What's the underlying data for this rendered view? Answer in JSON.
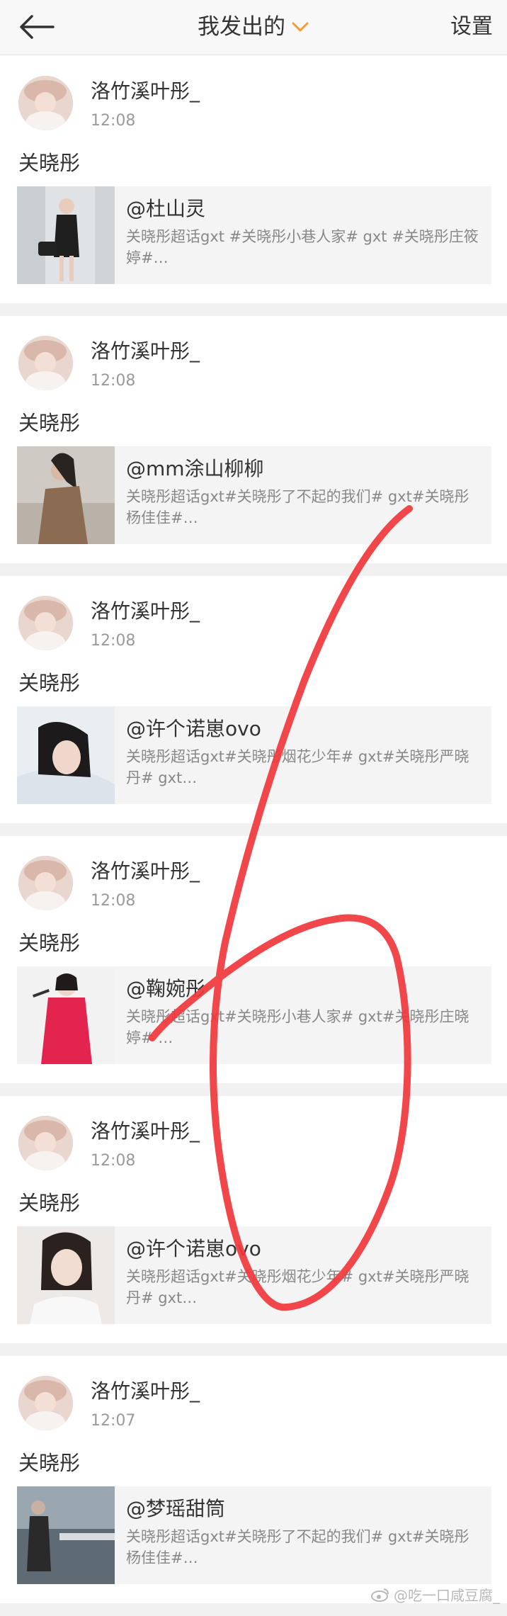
{
  "header": {
    "title": "我发出的",
    "settings_label": "设置"
  },
  "colors": {
    "accent_orange": "#f29b38",
    "annotation_red": "#f0363b"
  },
  "posts": [
    {
      "username": "洛竹溪叶彤_",
      "time": "12:08",
      "text": "关晓彤",
      "card_title": "@杜山灵",
      "card_desc": "关晓彤超话gxt #关晓彤小巷人家# gxt #关晓彤庄筱婷#…"
    },
    {
      "username": "洛竹溪叶彤_",
      "time": "12:08",
      "text": "关晓彤",
      "card_title": "@mm涂山柳柳",
      "card_desc": "关晓彤超话gxt#关晓彤了不起的我们# gxt#关晓彤杨佳佳#…"
    },
    {
      "username": "洛竹溪叶彤_",
      "time": "12:08",
      "text": "关晓彤",
      "card_title": "@许个诺崽ovo",
      "card_desc": "关晓彤超话gxt#关晓彤烟花少年# gxt#关晓彤严晓丹# gxt…"
    },
    {
      "username": "洛竹溪叶彤_",
      "time": "12:08",
      "text": "关晓彤",
      "card_title": "@鞠婉彤",
      "card_desc": "关晓彤超话gxt#关晓彤小巷人家# gxt#关晓彤庄晓婷# …"
    },
    {
      "username": "洛竹溪叶彤_",
      "time": "12:08",
      "text": "关晓彤",
      "card_title": "@许个诺崽ovo",
      "card_desc": "关晓彤超话gxt#关晓彤烟花少年# gxt#关晓彤严晓丹# gxt…"
    },
    {
      "username": "洛竹溪叶彤_",
      "time": "12:07",
      "text": "关晓彤",
      "card_title": "@梦瑶甜筒",
      "card_desc": "关晓彤超话gxt#关晓彤了不起的我们# gxt#关晓彤杨佳佳#…"
    }
  ],
  "watermark": {
    "text": "@吃一口咸豆腐_"
  }
}
